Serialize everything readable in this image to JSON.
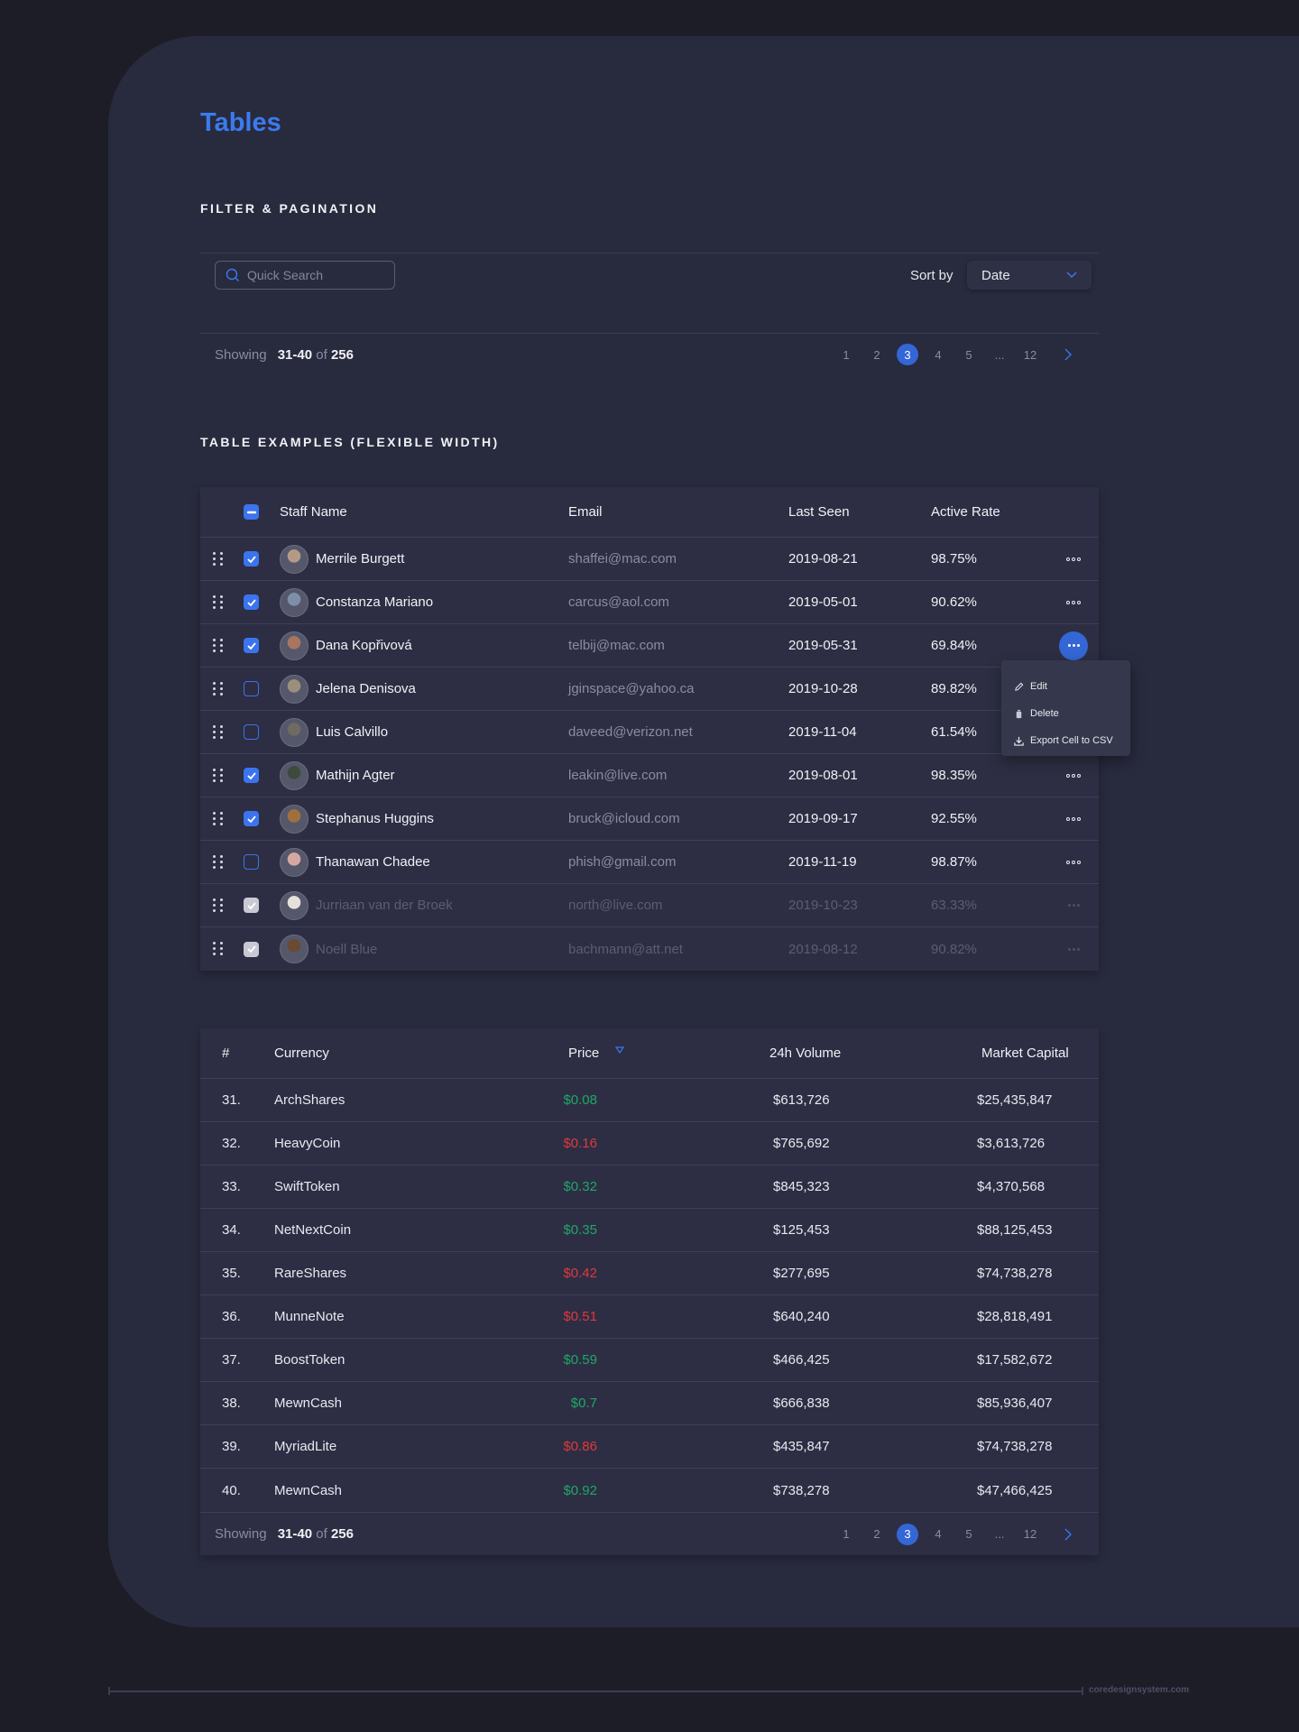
{
  "page": {
    "title": "Tables"
  },
  "filter_section": {
    "title": "FILTER & PAGINATION",
    "search": {
      "placeholder": "Quick Search",
      "value": ""
    },
    "sort": {
      "label": "Sort by",
      "selected": "Date"
    },
    "pagination": {
      "showing_label": "Showing",
      "range": "31-40",
      "of_label": "of",
      "total": "256",
      "pages": [
        "1",
        "2",
        "3",
        "4",
        "5",
        "...",
        "12"
      ],
      "current": "3"
    }
  },
  "table_section": {
    "title": "TABLE EXAMPLES (FLEXIBLE WIDTH)"
  },
  "staff_table": {
    "columns": [
      "Staff Name",
      "Email",
      "Last Seen",
      "Active Rate"
    ],
    "header_checkbox": "indeterminate",
    "rows": [
      {
        "name": "Merrile Burgett",
        "email": "shaffei@mac.com",
        "last_seen": "2019-08-21",
        "rate": "98.75%",
        "checked": true,
        "disabled": false,
        "avatar_color": "#b49a86"
      },
      {
        "name": "Constanza Mariano",
        "email": "carcus@aol.com",
        "last_seen": "2019-05-01",
        "rate": "90.62%",
        "checked": true,
        "disabled": false,
        "avatar_color": "#7d8fa8"
      },
      {
        "name": "Dana Kopřivová",
        "email": "telbij@mac.com",
        "last_seen": "2019-05-31",
        "rate": "69.84%",
        "checked": true,
        "disabled": false,
        "avatar_color": "#a87660",
        "menu_open": true
      },
      {
        "name": "Jelena Denisova",
        "email": "jginspace@yahoo.ca",
        "last_seen": "2019-10-28",
        "rate": "89.82%",
        "checked": false,
        "disabled": false,
        "avatar_color": "#9a8f7c"
      },
      {
        "name": "Luis Calvillo",
        "email": "daveed@verizon.net",
        "last_seen": "2019-11-04",
        "rate": "61.54%",
        "checked": false,
        "disabled": false,
        "avatar_color": "#6f6a62"
      },
      {
        "name": "Mathijn Agter",
        "email": "leakin@live.com",
        "last_seen": "2019-08-01",
        "rate": "98.35%",
        "checked": true,
        "disabled": false,
        "avatar_color": "#3e4a3c"
      },
      {
        "name": "Stephanus Huggins",
        "email": "bruck@icloud.com",
        "last_seen": "2019-09-17",
        "rate": "92.55%",
        "checked": true,
        "disabled": false,
        "avatar_color": "#a0703c"
      },
      {
        "name": "Thanawan Chadee",
        "email": "phish@gmail.com",
        "last_seen": "2019-11-19",
        "rate": "98.87%",
        "checked": false,
        "disabled": false,
        "avatar_color": "#d4a8a0"
      },
      {
        "name": "Jurriaan van der Broek",
        "email": "north@live.com",
        "last_seen": "2019-10-23",
        "rate": "63.33%",
        "checked": true,
        "disabled": true,
        "avatar_color": "#e6e0da"
      },
      {
        "name": "Noell Blue",
        "email": "bachmann@att.net",
        "last_seen": "2019-08-12",
        "rate": "90.82%",
        "checked": true,
        "disabled": true,
        "avatar_color": "#6a4a34"
      }
    ],
    "context_menu": [
      "Edit",
      "Delete",
      "Export Cell to CSV"
    ]
  },
  "currency_table": {
    "columns": [
      "#",
      "Currency",
      "Price",
      "24h Volume",
      "Market Capital"
    ],
    "sort_column": "Price",
    "rows": [
      {
        "num": "31.",
        "currency": "ArchShares",
        "price": "$0.08",
        "trend": "up",
        "volume": "$613,726",
        "cap": "$25,435,847"
      },
      {
        "num": "32.",
        "currency": "HeavyCoin",
        "price": "$0.16",
        "trend": "down",
        "volume": "$765,692",
        "cap": "$3,613,726"
      },
      {
        "num": "33.",
        "currency": "SwiftToken",
        "price": "$0.32",
        "trend": "up",
        "volume": "$845,323",
        "cap": "$4,370,568"
      },
      {
        "num": "34.",
        "currency": "NetNextCoin",
        "price": "$0.35",
        "trend": "up",
        "volume": "$125,453",
        "cap": "$88,125,453"
      },
      {
        "num": "35.",
        "currency": "RareShares",
        "price": "$0.42",
        "trend": "down",
        "volume": "$277,695",
        "cap": "$74,738,278"
      },
      {
        "num": "36.",
        "currency": "MunneNote",
        "price": "$0.51",
        "trend": "down",
        "volume": "$640,240",
        "cap": "$28,818,491"
      },
      {
        "num": "37.",
        "currency": "BoostToken",
        "price": "$0.59",
        "trend": "up",
        "volume": "$466,425",
        "cap": "$17,582,672"
      },
      {
        "num": "38.",
        "currency": "MewnCash",
        "price": "$0.7",
        "trend": "up",
        "volume": "$666,838",
        "cap": "$85,936,407"
      },
      {
        "num": "39.",
        "currency": "MyriadLite",
        "price": "$0.86",
        "trend": "down",
        "volume": "$435,847",
        "cap": "$74,738,278"
      },
      {
        "num": "40.",
        "currency": "MewnCash",
        "price": "$0.92",
        "trend": "up",
        "volume": "$738,278",
        "cap": "$47,466,425"
      }
    ],
    "pagination": {
      "showing_label": "Showing",
      "range": "31-40",
      "of_label": "of",
      "total": "256",
      "pages": [
        "1",
        "2",
        "3",
        "4",
        "5",
        "...",
        "12"
      ],
      "current": "3"
    }
  },
  "footer": {
    "text": "coredesignsystem.com"
  },
  "colors": {
    "accent": "#3b7bf0",
    "active_page": "#3466d6",
    "up": "#1fa868",
    "down": "#e0383e",
    "background": "#1d1d28",
    "card": "#282a3e"
  }
}
